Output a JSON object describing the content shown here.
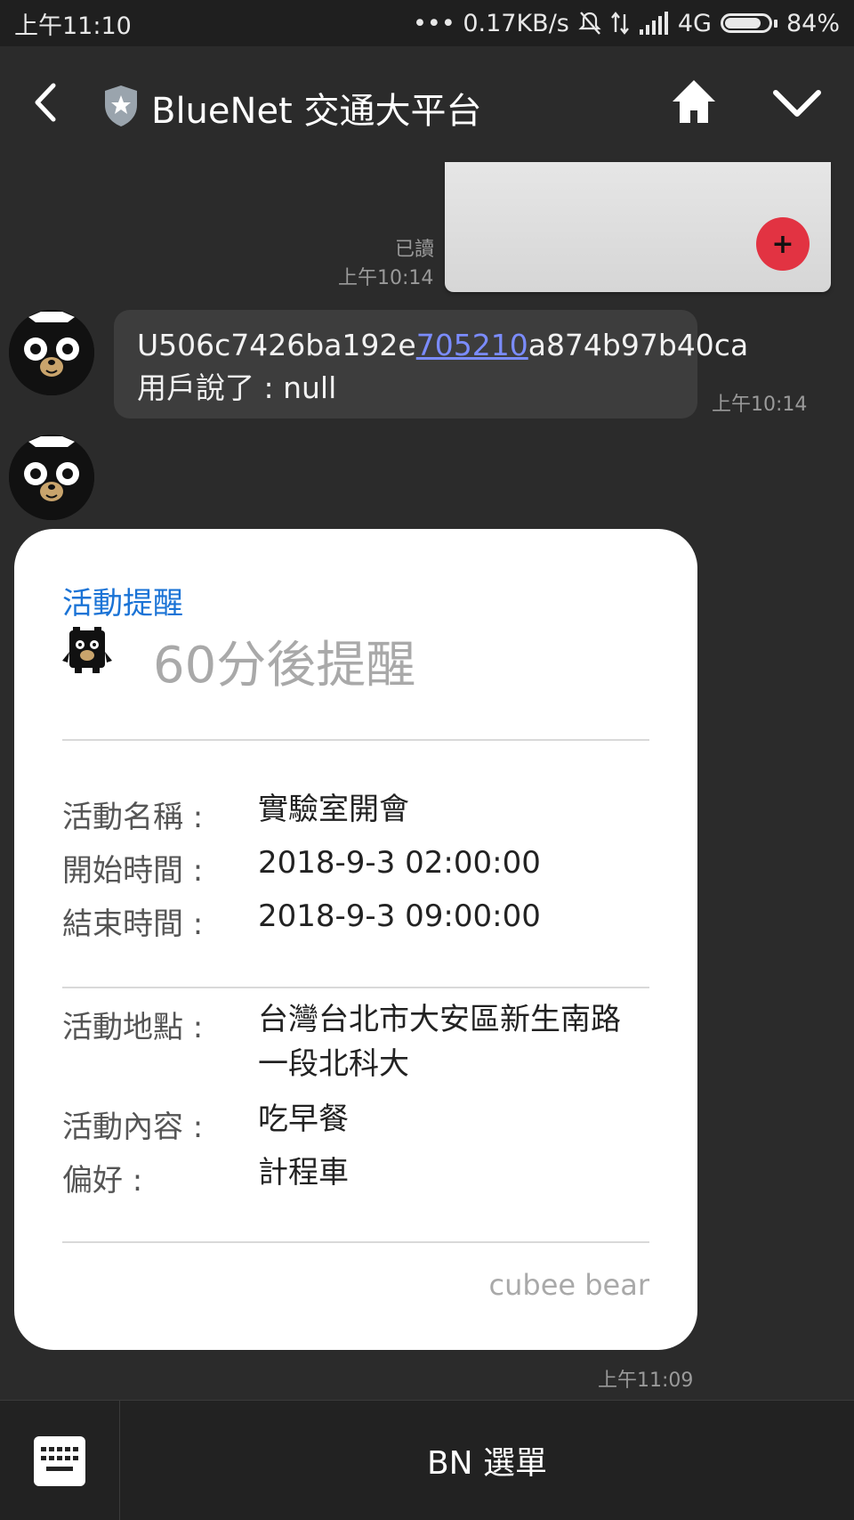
{
  "status_bar": {
    "time": "上午11:10",
    "net_speed": "••• 0.17KB/s",
    "network": "4G",
    "battery": "84%",
    "battery_level": 0.84
  },
  "header": {
    "title": "BlueNet 交通大平台"
  },
  "sent_image": {
    "read_status": "已讀",
    "time": "上午10:14"
  },
  "message1": {
    "text_before": "U506c7426ba192e",
    "link_text": "705210",
    "text_after": "a874b97b40ca 用戶說了 : null",
    "time": "上午10:14"
  },
  "card": {
    "header": "活動提醒",
    "big_text": "60分後提醒",
    "rows_top": [
      {
        "label": "活動名稱 :",
        "value": "實驗室開會"
      },
      {
        "label": "開始時間 :",
        "value": "2018-9-3 02:00:00"
      },
      {
        "label": "結束時間 :",
        "value": "2018-9-3 09:00:00"
      }
    ],
    "rows_bottom": [
      {
        "label": "活動地點 :",
        "value": "台灣台北市大安區新生南路一段北科大"
      },
      {
        "label": "活動內容 :",
        "value": "吃早餐"
      },
      {
        "label": "偏好 :",
        "value": "計程車"
      }
    ],
    "footer": "cubee bear",
    "time": "上午11:09"
  },
  "bottom_bar": {
    "menu_label": "BN 選單"
  },
  "colors": {
    "accent_blue": "#1a73d6",
    "link": "#7b8cff",
    "red_button": "#e23342"
  }
}
